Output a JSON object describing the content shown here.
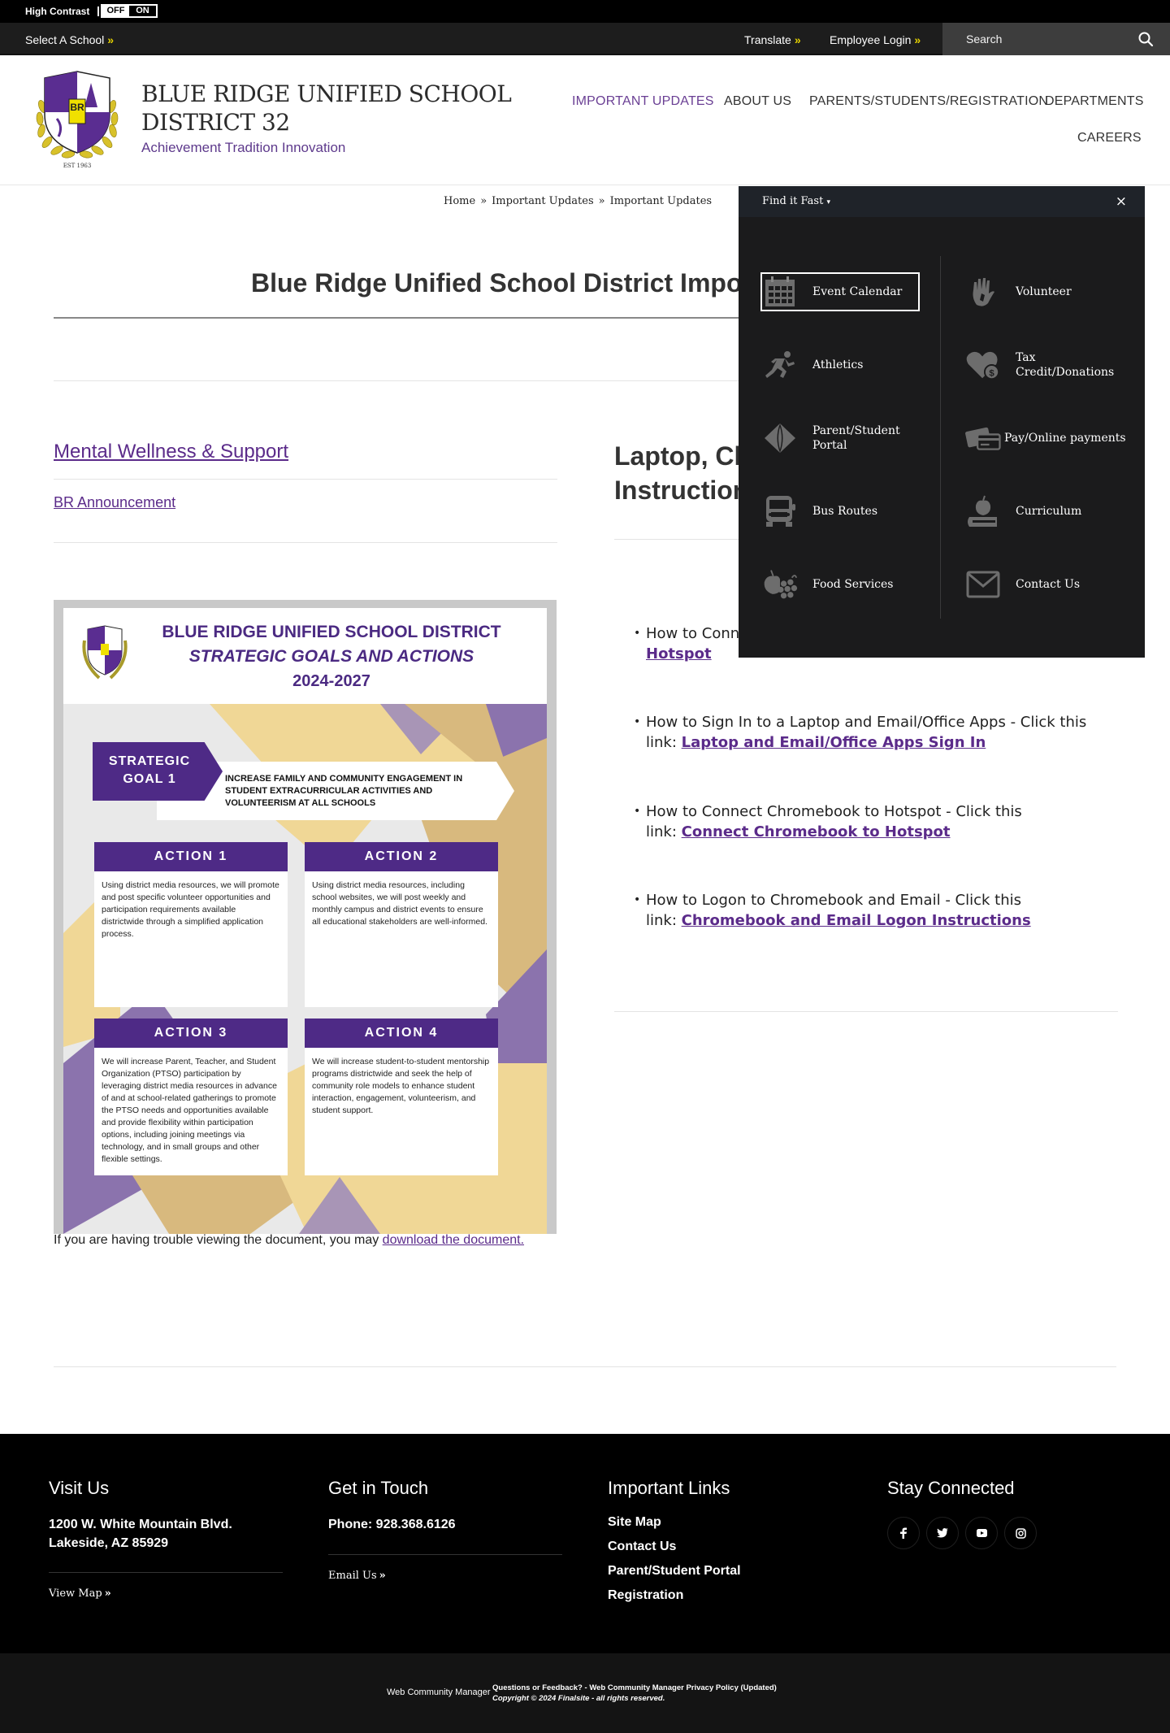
{
  "accessibility": {
    "high_contrast_label": "High Contrast",
    "toggle_off": "OFF",
    "toggle_on": "ON"
  },
  "utility_bar": {
    "select_school": "Select A School",
    "translate": "Translate",
    "employee_login": "Employee Login",
    "raquo": "»",
    "search_placeholder": "Search"
  },
  "header": {
    "site_name_line1": "BLUE RIDGE UNIFIED SCHOOL",
    "site_name_line2": "DISTRICT 32",
    "tagline": "Achievement Tradition Innovation",
    "logo_est": "EST 1963",
    "logo_initials": "BR",
    "nav": [
      {
        "label": "IMPORTANT UPDATES",
        "active": true
      },
      {
        "label": "ABOUT US",
        "active": false
      },
      {
        "label": "PARENTS/STUDENTS/REGISTRATION",
        "active": false
      },
      {
        "label": "DEPARTMENTS",
        "active": false
      },
      {
        "label": "CAREERS",
        "active": false
      }
    ]
  },
  "breadcrumb": {
    "items": [
      "Home",
      "Important Updates",
      "Important Updates"
    ],
    "separator": "»"
  },
  "page": {
    "title": "Blue Ridge Unified School District Important Updates",
    "left_links": {
      "mental_wellness": "Mental Wellness & Support",
      "br_announcement": "BR Announcement"
    },
    "right_heading": "Laptop, Chromebook, and Hotspot Instructions",
    "howto": [
      {
        "text": "How to Connect a Laptop to Hotspot - Click this link: ",
        "link": "Laptop to Hotspot"
      },
      {
        "text": "How to Sign In to a Laptop and Email/Office Apps - Click this link: ",
        "link": "Laptop and Email/Office Apps Sign In"
      },
      {
        "text": "How to Connect Chromebook to Hotspot - Click this link: ",
        "link": "Connect Chromebook to Hotspot"
      },
      {
        "text": "How to Logon to Chromebook and Email - Click this link: ",
        "link": "Chromebook and Email Logon Instructions"
      }
    ],
    "doc_note": "If you are having trouble viewing the document, you may ",
    "doc_note_link": "download the document."
  },
  "poster": {
    "title_line1": "BLUE RIDGE UNIFIED SCHOOL DISTRICT",
    "title_line2": "STRATEGIC GOALS AND ACTIONS",
    "title_line3": "2024-2027",
    "goal_label": "STRATEGIC GOAL 1",
    "goal_text": "INCREASE FAMILY AND COMMUNITY ENGAGEMENT IN STUDENT EXTRACURRICULAR ACTIVITIES AND VOLUNTEERISM AT ALL SCHOOLS",
    "actions": [
      {
        "title": "ACTION 1",
        "body": "Using district media resources, we will promote and post specific volunteer opportunities and participation requirements available districtwide through a simplified application process."
      },
      {
        "title": "ACTION 2",
        "body": "Using district media resources, including school websites, we will post weekly and monthly campus and district events to ensure all educational stakeholders are well-informed."
      },
      {
        "title": "ACTION 3",
        "body": "We will increase Parent, Teacher, and Student Organization (PTSO) participation by leveraging district media resources in advance of and at school-related gatherings to promote the PTSO needs and opportunities available and provide flexibility within participation options, including joining meetings via technology, and in small groups and other flexible settings."
      },
      {
        "title": "ACTION 4",
        "body": "We will increase student-to-student mentorship programs districtwide and seek the help of community role models to enhance student interaction, engagement, volunteerism, and student support."
      }
    ],
    "colors": {
      "purple": "#4e2a86",
      "gold": "#f0d796",
      "tan": "#d8b97e",
      "lavender": "#8b73ad"
    }
  },
  "find_it_fast": {
    "title": "Find it Fast",
    "close": "×",
    "items": [
      {
        "label": "Event Calendar",
        "icon": "calendar-icon"
      },
      {
        "label": "Volunteer",
        "icon": "hand-icon"
      },
      {
        "label": "Athletics",
        "icon": "runner-icon"
      },
      {
        "label": "Tax Credit/Donations",
        "icon": "heart-dollar-icon"
      },
      {
        "label": "Parent/Student Portal",
        "icon": "portal-icon"
      },
      {
        "label": "Pay/Online payments",
        "icon": "credit-card-icon"
      },
      {
        "label": "Bus Routes",
        "icon": "bus-icon"
      },
      {
        "label": "Curriculum",
        "icon": "apple-book-icon"
      },
      {
        "label": "Food Services",
        "icon": "fruit-icon"
      },
      {
        "label": "Contact Us",
        "icon": "envelope-icon"
      }
    ]
  },
  "footer": {
    "visit": {
      "heading": "Visit Us",
      "address1": "1200 W. White Mountain Blvd.",
      "address2": "Lakeside, AZ 85929",
      "map_link": "View Map"
    },
    "contact": {
      "heading": "Get in Touch",
      "phone": "Phone: 928.368.6126",
      "email_link": "Email Us"
    },
    "links": {
      "heading": "Important Links",
      "items": [
        "Site Map",
        "Contact Us",
        "Parent/Student Portal",
        "Registration"
      ]
    },
    "social": {
      "heading": "Stay Connected",
      "items": [
        "facebook",
        "twitter",
        "youtube",
        "instagram"
      ]
    },
    "bottom": {
      "wcm": "Web Community Manager",
      "feedback": "Questions or Feedback?",
      "dash": " - ",
      "privacy": "Web Community Manager Privacy Policy (Updated)",
      "copyright": "Copyright © 2024 Finalsite - all rights reserved."
    }
  },
  "colors": {
    "brand_purple": "#5b2b8a",
    "accent_yellow": "#e5d200",
    "dark_bar": "#1d1d1d",
    "panel_bg": "#1b1b1c"
  }
}
